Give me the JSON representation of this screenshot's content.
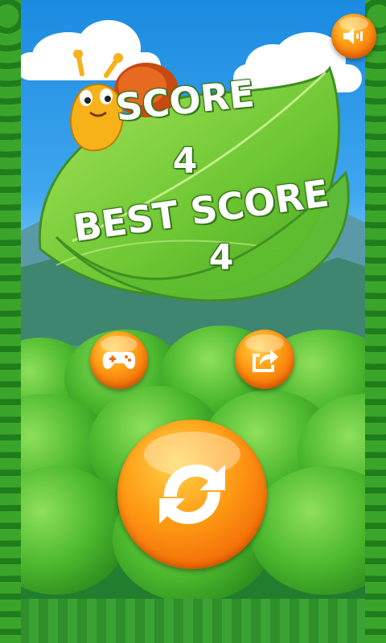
{
  "game": {
    "score_label": "SCORE",
    "score_value": "4",
    "best_score_label": "BEST SCORE",
    "best_score_value": "4"
  },
  "buttons": {
    "sound": {
      "icon": "speaker-icon"
    },
    "more_games": {
      "icon": "gamepad-icon"
    },
    "share": {
      "icon": "share-icon"
    },
    "replay": {
      "icon": "replay-icon"
    }
  },
  "colors": {
    "button_orange": "#f26a05",
    "leaf_green": "#7bcf3a",
    "sky_blue": "#2a93e6"
  }
}
